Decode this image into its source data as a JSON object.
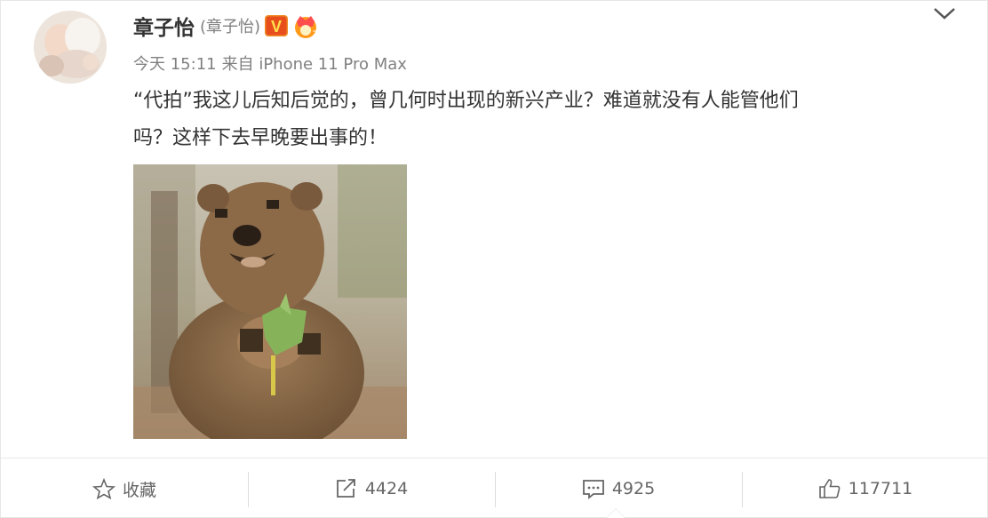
{
  "post": {
    "author": {
      "name": "章子怡",
      "remark": "(章子怡)",
      "verified_badge": "V",
      "member_icon": "crown-icon"
    },
    "time": "今天 15:11",
    "source": "来自 iPhone 11 Pro Max",
    "text_line1": "“代拍”我这儿后知后觉的，曾几何时出现的新兴产业？难道就没有人能管他们",
    "text_line2": "吗？这样下去早晚要出事的！",
    "image_icon": "quokka-photo"
  },
  "actions": {
    "favorite_label": "收藏",
    "repost_count": "4424",
    "comment_count": "4925",
    "like_count": "117711"
  },
  "colors": {
    "verified": "#f5a623",
    "crown": "#ff8c00",
    "text": "#333333",
    "muted": "#808080"
  }
}
